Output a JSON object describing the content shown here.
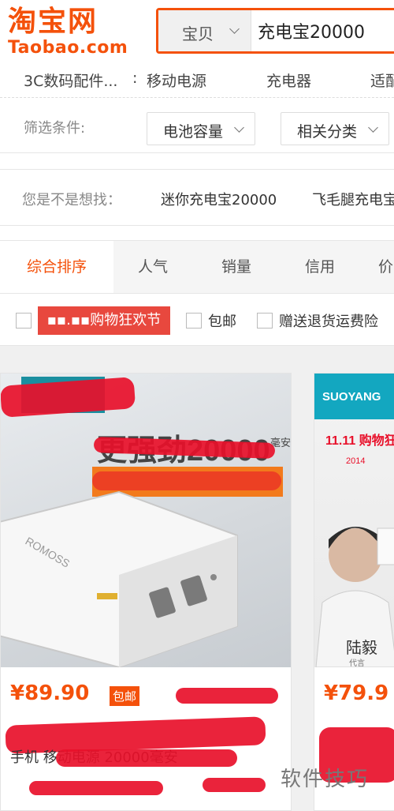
{
  "logo": {
    "cn": "淘宝网",
    "en": "Taobao.com"
  },
  "search": {
    "type_label": "宝贝",
    "query": "充电宝20000"
  },
  "categories": [
    "3C数码配件...",
    ":",
    "移动电源",
    "充电器",
    "适配"
  ],
  "filter": {
    "label": "筛选条件:",
    "buttons": [
      "电池容量",
      "相关分类"
    ]
  },
  "suggest": {
    "label": "您是不是想找：",
    "items": [
      "迷你充电宝20000",
      "飞毛腿充电宝"
    ]
  },
  "sort_tabs": [
    "综合排序",
    "人气",
    "销量",
    "信用",
    "价"
  ],
  "checks": {
    "promo": "▪▪.▪▪购物狂欢节",
    "free_shipping": "包邮",
    "return_insurance": "赠送退货运费险"
  },
  "products": [
    {
      "image_text": {
        "headline": "更强劲20000",
        "unit": "毫安",
        "brand": "ROMOSS"
      },
      "price": "¥89.90",
      "ship_tag": "包邮",
      "title_line2": "手机   移动电源 20000毫安"
    },
    {
      "image_text": {
        "brand": "SUOYANG",
        "festival": "11.11 购物狂欢节",
        "year": "2014",
        "person": "陆毅",
        "sub": "代言"
      },
      "price": "¥79.9"
    }
  ],
  "watermark": "软件技巧",
  "colors": {
    "accent": "#f4510b",
    "promo": "#e8483e",
    "scribble": "#e8102a"
  }
}
